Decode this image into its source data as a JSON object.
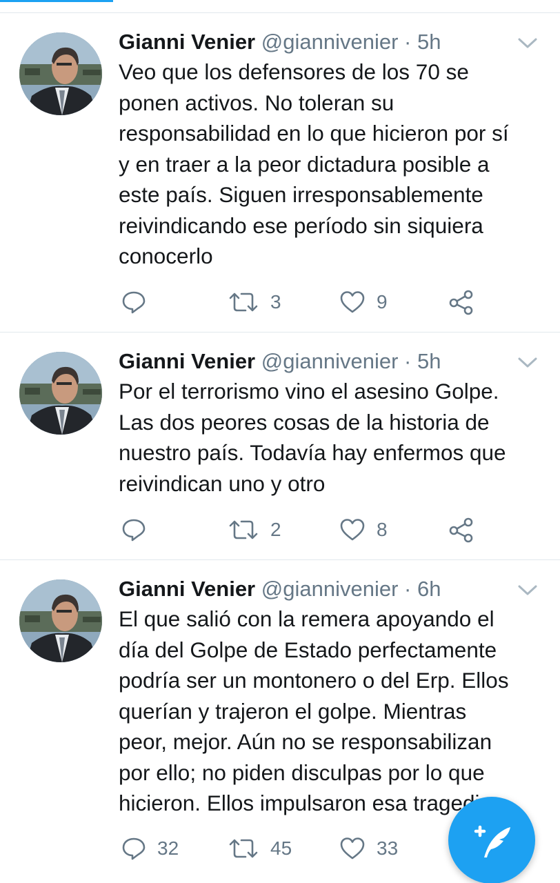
{
  "colors": {
    "accent": "#1da1f2",
    "text": "#14171a",
    "muted": "#657786",
    "divider": "#e1e8ed"
  },
  "icons": {
    "avatar": "profile-photo",
    "menu": "chevron-down-icon",
    "reply": "reply-icon",
    "retweet": "retweet-icon",
    "like": "heart-icon",
    "share": "share-icon",
    "compose": "compose-tweet-icon"
  },
  "tweets": [
    {
      "name": "Gianni Venier",
      "handle": "@giannivenier",
      "separator": "·",
      "time": "5h",
      "lines": [
        "Veo que los defensores de los 70 se",
        "ponen activos. No toleran su",
        "responsabilidad en lo que hicieron por sí",
        "y en traer a la peor dictadura posible a",
        "este país. Siguen irresponsablemente",
        "reivindicando ese período sin siquiera",
        "conocerlo"
      ],
      "retweets": "3",
      "likes": "9"
    },
    {
      "name": "Gianni Venier",
      "handle": "@giannivenier",
      "separator": "·",
      "time": "5h",
      "lines": [
        "Por el terrorismo vino el asesino Golpe.",
        "Las dos peores cosas de la historia de",
        "nuestro país.  Todavía hay enfermos que",
        "reivindican uno y otro"
      ],
      "retweets": "2",
      "likes": "8"
    },
    {
      "name": "Gianni Venier",
      "handle": "@giannivenier",
      "separator": "·",
      "time": "6h",
      "lines": [
        "El que salió con la remera apoyando el",
        "día del Golpe de Estado perfectamente",
        "podría ser un montonero o del Erp. Ellos",
        "querían y trajeron el golpe. Mientras",
        "peor, mejor. Aún no se responsabilizan",
        "por ello; no piden disculpas por lo que",
        "hicieron. Ellos impulsaron esa tragedia"
      ],
      "replies": "32",
      "retweets": "45",
      "likes": "33"
    }
  ]
}
